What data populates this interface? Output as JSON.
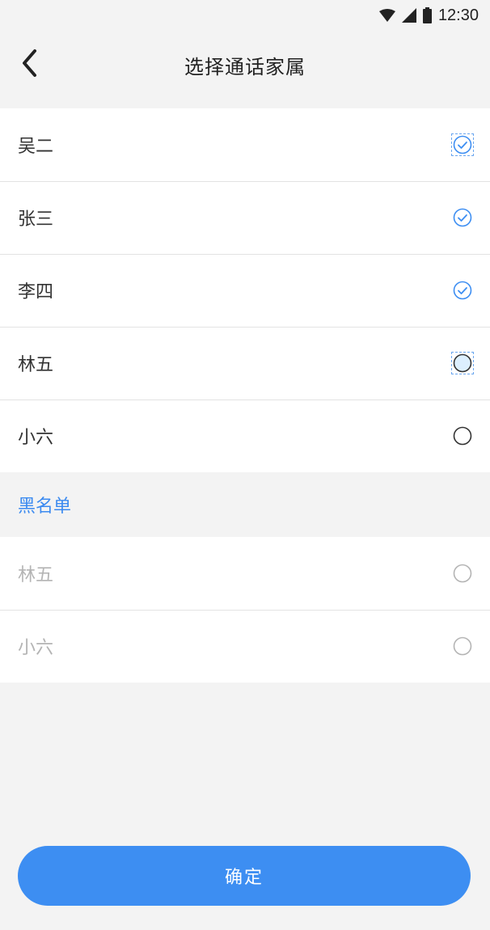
{
  "status_bar": {
    "time": "12:30",
    "icons": [
      "wifi-icon",
      "signal-icon",
      "battery-icon"
    ]
  },
  "nav": {
    "title": "选择通话家属",
    "back_icon": "chevron-left-icon"
  },
  "contacts": [
    {
      "name": "吴二",
      "checked": true
    },
    {
      "name": "张三",
      "checked": true
    },
    {
      "name": "李四",
      "checked": true
    },
    {
      "name": "林五",
      "checked": false
    },
    {
      "name": "小六",
      "checked": false
    }
  ],
  "blacklist": {
    "title": "黑名单",
    "items": [
      {
        "name": "林五",
        "checked": false,
        "disabled": true
      },
      {
        "name": "小六",
        "checked": false,
        "disabled": true
      }
    ]
  },
  "confirm_label": "确定",
  "colors": {
    "accent": "#3d8ef2",
    "section_title": "#3b8af0",
    "background": "#f3f3f3"
  }
}
